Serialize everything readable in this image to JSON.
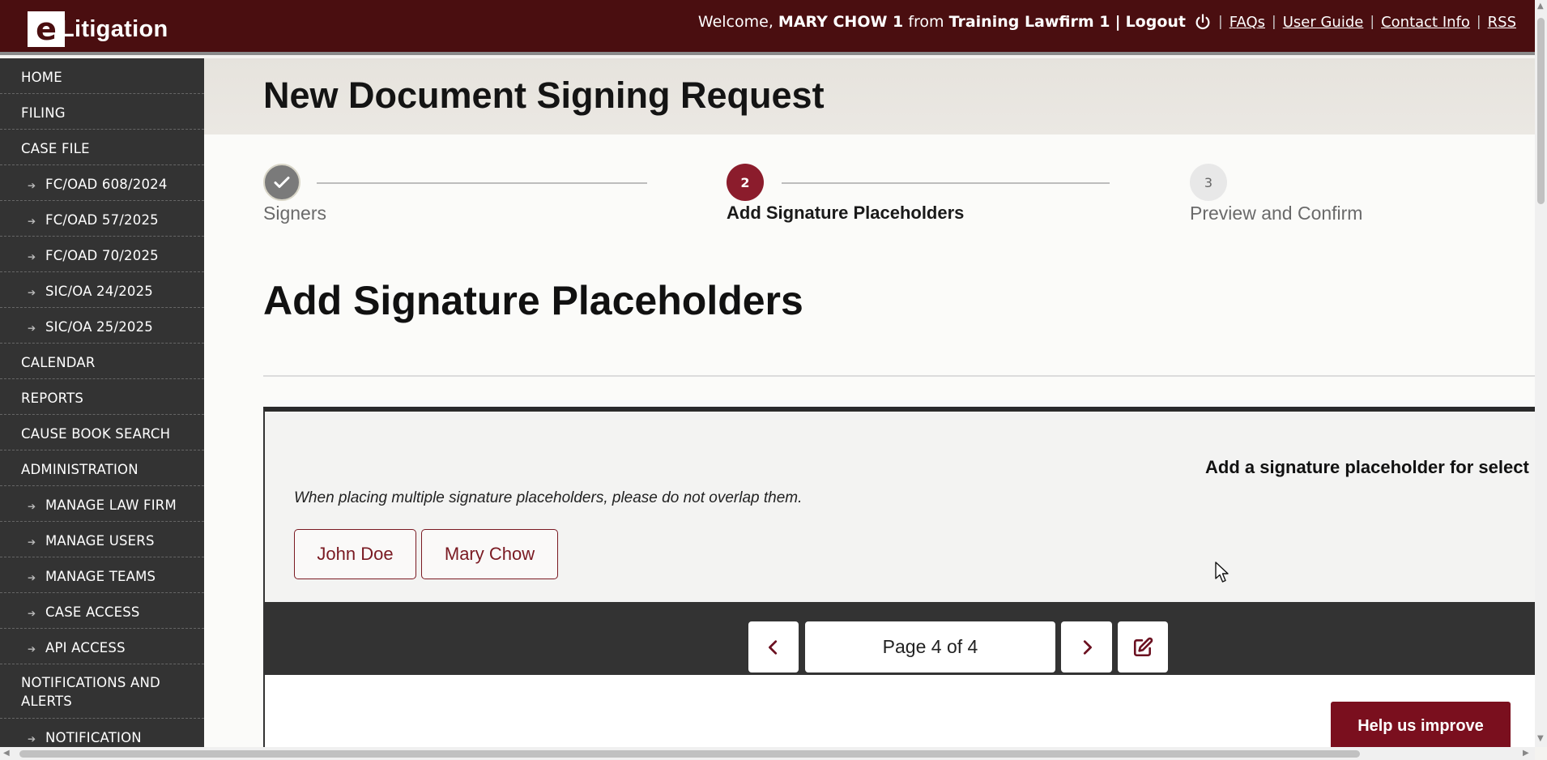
{
  "header": {
    "logo_letter": "e",
    "logo_text": "Litigation",
    "welcome": "Welcome,",
    "user": "MARY CHOW 1",
    "from": "from",
    "firm": "Training Lawfirm 1",
    "pipe": "|",
    "logout": "Logout",
    "links": [
      "FAQs",
      "User Guide",
      "Contact Info",
      "RSS"
    ]
  },
  "sidebar": {
    "items": [
      {
        "label": "HOME"
      },
      {
        "label": "FILING"
      },
      {
        "label": "CASE FILE"
      },
      {
        "label": "FC/OAD 608/2024"
      },
      {
        "label": "FC/OAD 57/2025"
      },
      {
        "label": "FC/OAD 70/2025"
      },
      {
        "label": "SIC/OA 24/2025"
      },
      {
        "label": "SIC/OA 25/2025"
      },
      {
        "label": "CALENDAR"
      },
      {
        "label": "REPORTS"
      },
      {
        "label": "CAUSE BOOK SEARCH"
      },
      {
        "label": "ADMINISTRATION"
      },
      {
        "label": "MANAGE LAW FIRM"
      },
      {
        "label": "MANAGE USERS"
      },
      {
        "label": "MANAGE TEAMS"
      },
      {
        "label": "CASE ACCESS"
      },
      {
        "label": "API ACCESS"
      },
      {
        "label": "NOTIFICATIONS AND ALERTS"
      },
      {
        "label": "NOTIFICATION"
      }
    ]
  },
  "main": {
    "page_title": "New Document Signing Request",
    "steps": [
      {
        "number": "",
        "label": "Signers",
        "state": "done"
      },
      {
        "number": "2",
        "label": "Add Signature Placeholders",
        "state": "active"
      },
      {
        "number": "3",
        "label": "Preview and Confirm",
        "state": "pending"
      }
    ],
    "section_title": "Add Signature Placeholders",
    "panel": {
      "heading": "Add a signature placeholder for select",
      "note": "When placing multiple signature placeholders, please do not overlap them.",
      "signers": [
        "John Doe",
        "Mary Chow"
      ]
    },
    "pager": {
      "page_text": "Page 4 of 4"
    }
  },
  "help_button": "Help us improve",
  "colors": {
    "brand": "#4a0e10",
    "accent": "#7a1a22",
    "sidebar": "#333333"
  }
}
